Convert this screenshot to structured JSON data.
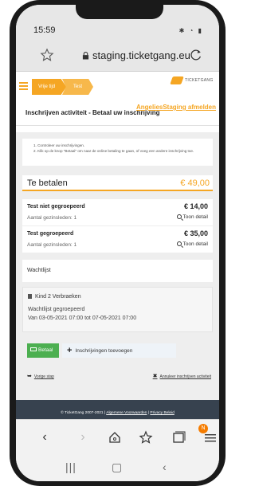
{
  "status_bar": {
    "time": "15:59"
  },
  "browser": {
    "url": "staging.ticketgang.eu"
  },
  "breadcrumbs": [
    {
      "label": "Vrije tijd"
    },
    {
      "label": "Test"
    }
  ],
  "brand": {
    "name": "TICKETGANG",
    "accent_color": "#f5a623"
  },
  "page": {
    "title": "Inschrijven activiteit - Betaal uw inschrijving",
    "logout_link": "AngeliesStaging afmelden"
  },
  "instructions": [
    "1. Controleer uw inschrijvingen.",
    "2. Klik op de knop \"Betaal\" om naar de online betaling te gaan, of voeg een andere inschrijving toe."
  ],
  "total": {
    "label": "Te betalen",
    "value": "€ 49,00"
  },
  "items": [
    {
      "name": "Test niet gegroepeerd",
      "price": "€ 14,00",
      "meta": "Aantal gezinsleden: 1",
      "detail_label": "Toon detail"
    },
    {
      "name": "Test gegroepeerd",
      "price": "€ 35,00",
      "meta": "Aantal gezinsleden: 1",
      "detail_label": "Toon detail"
    }
  ],
  "waitlist": {
    "heading": "Wachtlijst",
    "name": "Kind 2 Verbraeken",
    "status": "Wachtlijst gegroepeerd",
    "dates": "Van 03-05-2021 07:00 tot 07-05-2021 07:00"
  },
  "actions": {
    "pay_label": "Betaal",
    "add_label": "Inschrijvingen toevoegen",
    "back_label": "Vorige stap",
    "cancel_label": "Annuleer inschrijven activiteit"
  },
  "footer": {
    "copyright": "© TicketGang 2007-2021 |",
    "terms": "Algemene Voorwaarden",
    "separator": "|",
    "privacy": "Privacy Beleid"
  },
  "bottom_nav": {
    "badge": "N"
  }
}
